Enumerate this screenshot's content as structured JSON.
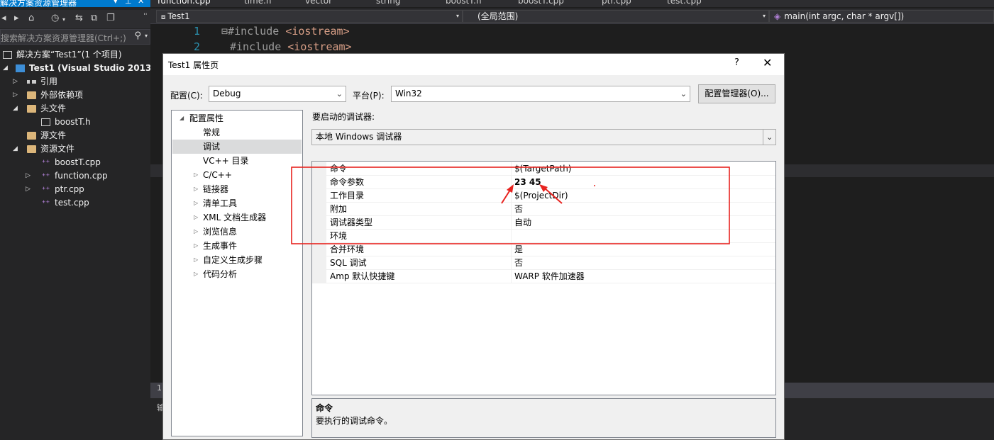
{
  "solution_explorer": {
    "title": "解决方案资源管理器",
    "search_placeholder": "搜索解决方案资源管理器(Ctrl+;)",
    "tree": [
      {
        "label": "解决方案“Test1”(1 个项目)",
        "level": 0,
        "icon": "solution-icon",
        "arrow": ""
      },
      {
        "label": "Test1 (Visual Studio 2013)",
        "level": 0,
        "icon": "project-icon",
        "arrow": "expanded",
        "bold": true
      },
      {
        "label": "引用",
        "level": 1,
        "icon": "references-icon",
        "arrow": "collapsed"
      },
      {
        "label": "外部依赖项",
        "level": 1,
        "icon": "folder-icon",
        "arrow": "collapsed"
      },
      {
        "label": "头文件",
        "level": 1,
        "icon": "folder-icon",
        "arrow": "expanded"
      },
      {
        "label": "boostT.h",
        "level": 2,
        "icon": "header-file-icon",
        "arrow": ""
      },
      {
        "label": "源文件",
        "level": 1,
        "icon": "folder-icon",
        "arrow": ""
      },
      {
        "label": "资源文件",
        "level": 1,
        "icon": "folder-icon",
        "arrow": "expanded"
      },
      {
        "label": "boostT.cpp",
        "level": 2,
        "icon": "cpp-file-icon",
        "arrow": ""
      },
      {
        "label": "function.cpp",
        "level": 2,
        "icon": "cpp-file-icon",
        "arrow": "collapsed"
      },
      {
        "label": "ptr.cpp",
        "level": 2,
        "icon": "cpp-file-icon",
        "arrow": "collapsed"
      },
      {
        "label": "test.cpp",
        "level": 2,
        "icon": "cpp-file-icon",
        "arrow": ""
      }
    ]
  },
  "editor": {
    "tabs": [
      "function.cpp",
      "time.h",
      "vector",
      "string",
      "boostT.h",
      "boostT.cpp",
      "ptr.cpp",
      "test.cpp"
    ],
    "nav_project": "Test1",
    "nav_scope": "(全局范围)",
    "nav_member": "main(int argc, char * argv[])",
    "lines": [
      {
        "num": "1",
        "text": "#include ",
        "arg": "<iostream>",
        "fold": "⊟"
      },
      {
        "num": "2",
        "text": "#include ",
        "arg": "<iostream>",
        "fold": ""
      }
    ],
    "edge_num": "1",
    "edge_char": "输"
  },
  "dialog": {
    "title": "Test1 属性页",
    "help": "?",
    "close": "✕",
    "config_label": "配置(C):",
    "config_value": "Debug",
    "platform_label": "平台(P):",
    "platform_value": "Win32",
    "config_manager_button": "配置管理器(O)...",
    "debugger_label": "要启动的调试器:",
    "debugger_value": "本地 Windows 调试器",
    "nav": [
      {
        "label": "配置属性",
        "arrow": "expanded",
        "level": 0
      },
      {
        "label": "常规",
        "arrow": "",
        "level": 1
      },
      {
        "label": "调试",
        "arrow": "",
        "level": 1,
        "selected": true
      },
      {
        "label": "VC++ 目录",
        "arrow": "",
        "level": 1
      },
      {
        "label": "C/C++",
        "arrow": "collapsed",
        "level": 1
      },
      {
        "label": "链接器",
        "arrow": "collapsed",
        "level": 1
      },
      {
        "label": "清单工具",
        "arrow": "collapsed",
        "level": 1
      },
      {
        "label": "XML 文档生成器",
        "arrow": "collapsed",
        "level": 1
      },
      {
        "label": "浏览信息",
        "arrow": "collapsed",
        "level": 1
      },
      {
        "label": "生成事件",
        "arrow": "collapsed",
        "level": 1
      },
      {
        "label": "自定义生成步骤",
        "arrow": "collapsed",
        "level": 1
      },
      {
        "label": "代码分析",
        "arrow": "collapsed",
        "level": 1
      }
    ],
    "properties": [
      {
        "name": "命令",
        "value": "$(TargetPath)"
      },
      {
        "name": "命令参数",
        "value": "23 45",
        "bold": true
      },
      {
        "name": "工作目录",
        "value": "$(ProjectDir)"
      },
      {
        "name": "附加",
        "value": "否"
      },
      {
        "name": "调试器类型",
        "value": "自动"
      },
      {
        "name": "环境",
        "value": ""
      },
      {
        "name": "合并环境",
        "value": "是"
      },
      {
        "name": "SQL 调试",
        "value": "否"
      },
      {
        "name": "Amp 默认快捷键",
        "value": "WARP 软件加速器"
      }
    ],
    "description_title": "命令",
    "description_body": "要执行的调试命令。"
  },
  "colors": {
    "accent": "#007acc",
    "annotation": "#e8231f",
    "code_include": "#d69d85",
    "line_number": "#2b91af"
  }
}
